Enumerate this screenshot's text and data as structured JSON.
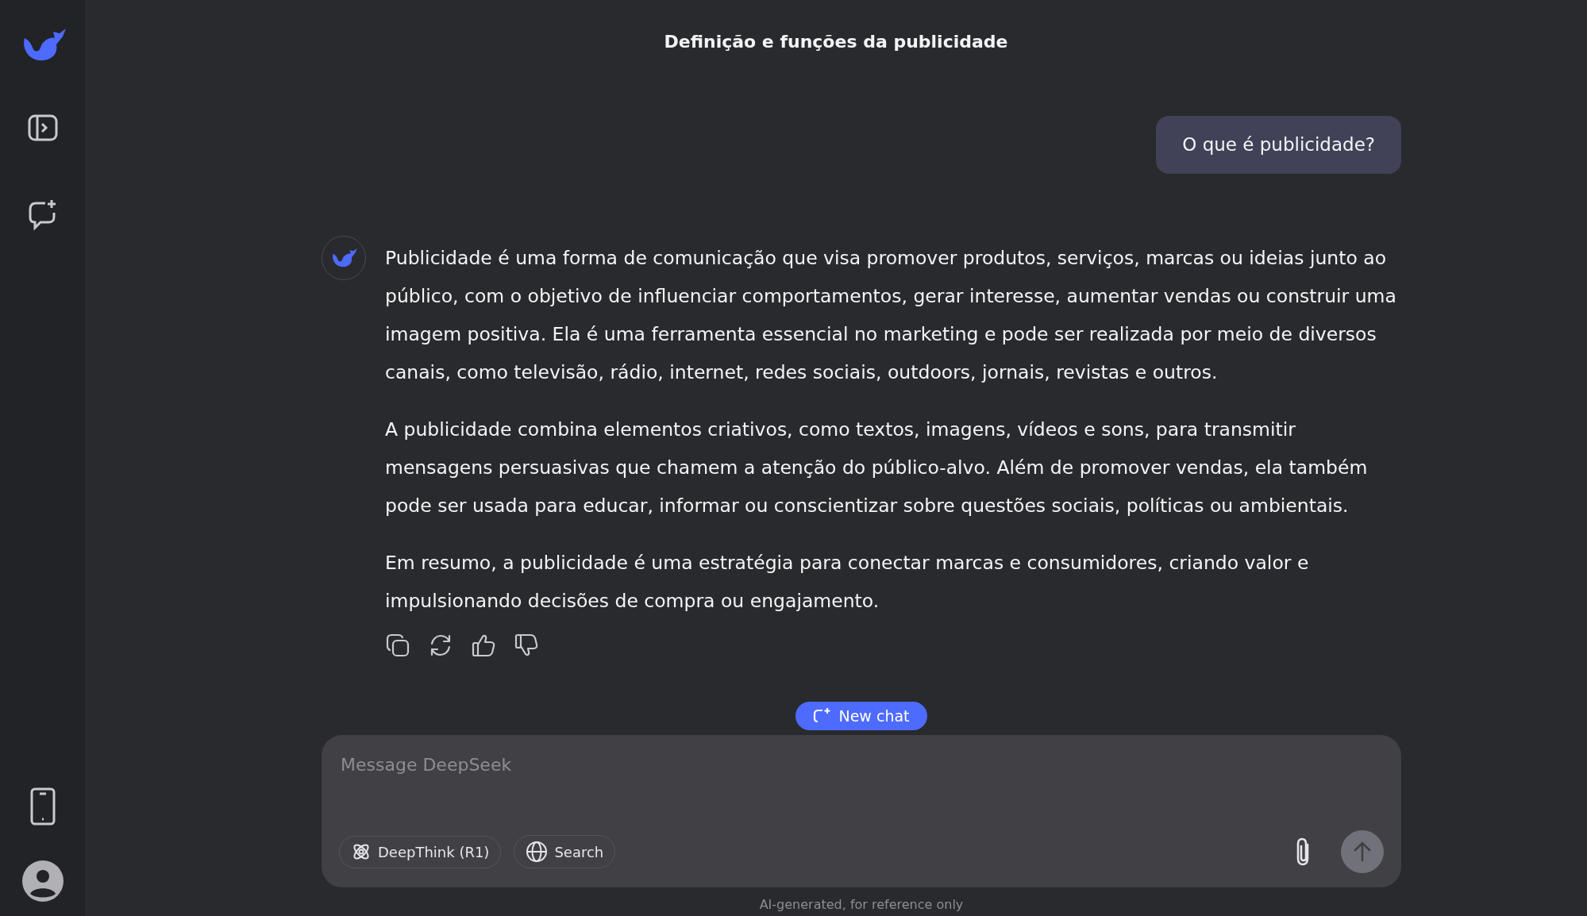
{
  "chat": {
    "title": "Definição e funções da publicidade"
  },
  "messages": [
    {
      "kind": "user",
      "text": "O que é publicidade?"
    },
    {
      "kind": "assistant",
      "paragraphs": [
        "Publicidade é uma forma de comunicação que visa promover produtos, serviços, marcas ou ideias junto ao público, com o objetivo de influenciar comportamentos, gerar interesse, aumentar vendas ou construir uma imagem positiva. Ela é uma ferramenta essencial no marketing e pode ser realizada por meio de diversos canais, como televisão, rádio, internet, redes sociais, outdoors, jornais, revistas e outros.",
        "A publicidade combina elementos criativos, como textos, imagens, vídeos e sons, para transmitir mensagens persuasivas que chamem a atenção do público-alvo. Além de promover vendas, ela também pode ser usada para educar, informar ou conscientizar sobre questões sociais, políticas ou ambientais.",
        "Em resumo, a publicidade é uma estratégia para conectar marcas e consumidores, criando valor e impulsionando decisões de compra ou engajamento."
      ]
    }
  ],
  "new_chat_button": "New chat",
  "composer": {
    "placeholder": "Message DeepSeek",
    "toggles": [
      {
        "kind": "deepthink",
        "label": "DeepThink (R1)",
        "on": false
      },
      {
        "kind": "search",
        "label": "Search",
        "on": false
      }
    ],
    "send_disabled": true
  },
  "footer": "AI-generated, for reference only"
}
